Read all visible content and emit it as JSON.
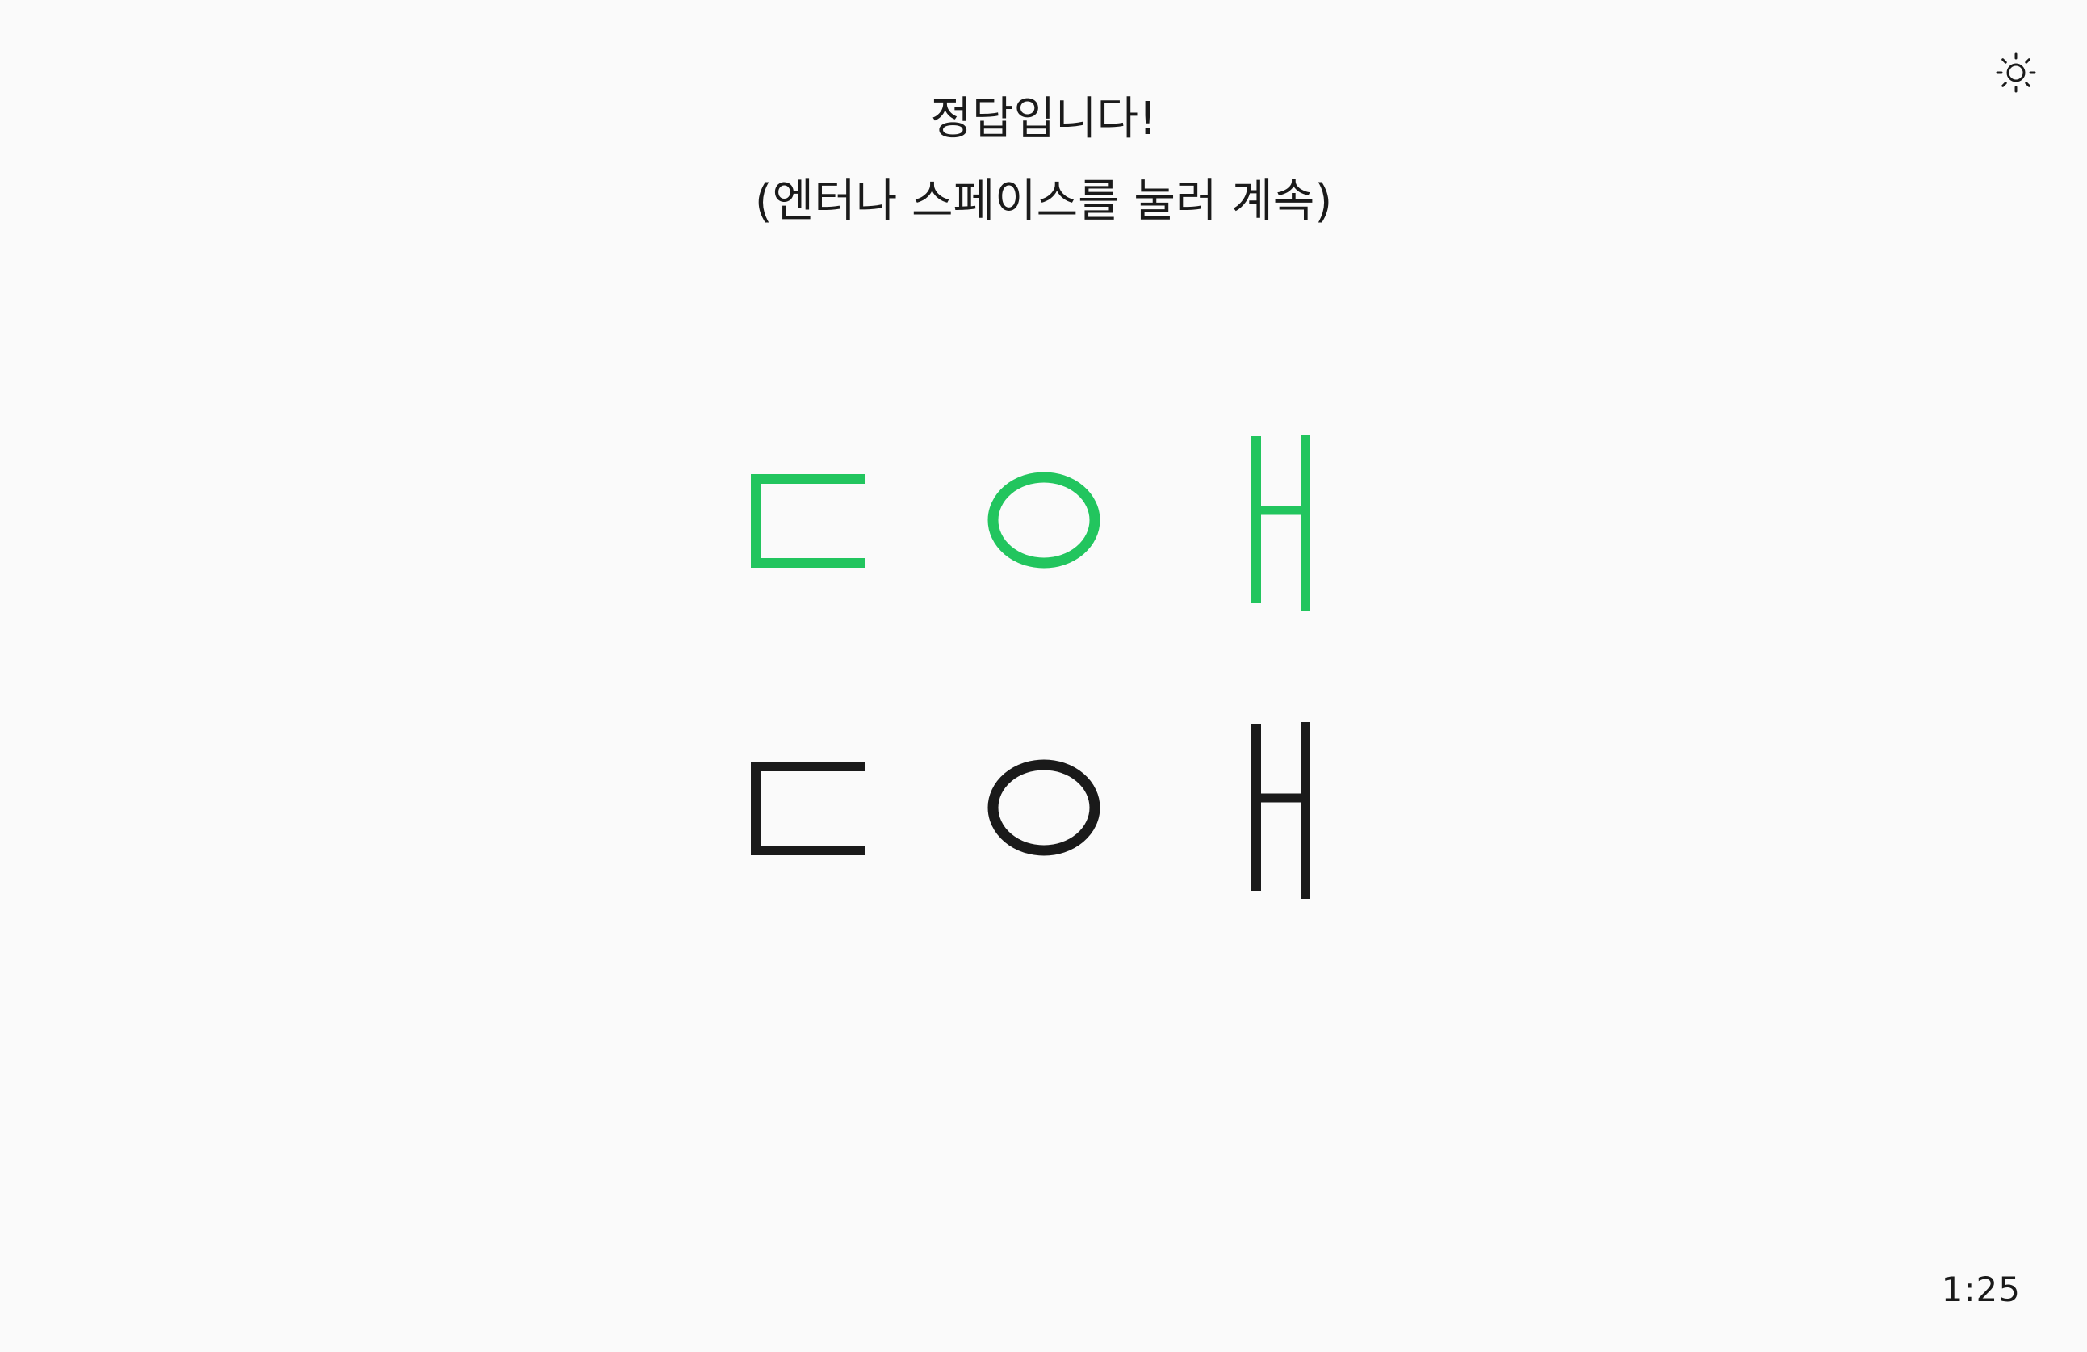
{
  "feedback": {
    "title": "정답입니다!",
    "hint": "(엔터나 스페이스를 눌러 계속)"
  },
  "answer_row": {
    "jamo": [
      "ㄷ",
      "ㅇ",
      "ㅐ"
    ],
    "status": "correct",
    "color": "#22c55e"
  },
  "input_row": {
    "jamo": [
      "ㄷ",
      "ㅇ",
      "ㅐ"
    ],
    "color": "#1a1a1a"
  },
  "timer": {
    "value": "1:25"
  },
  "controls": {
    "theme_toggle_icon": "sun-icon"
  }
}
